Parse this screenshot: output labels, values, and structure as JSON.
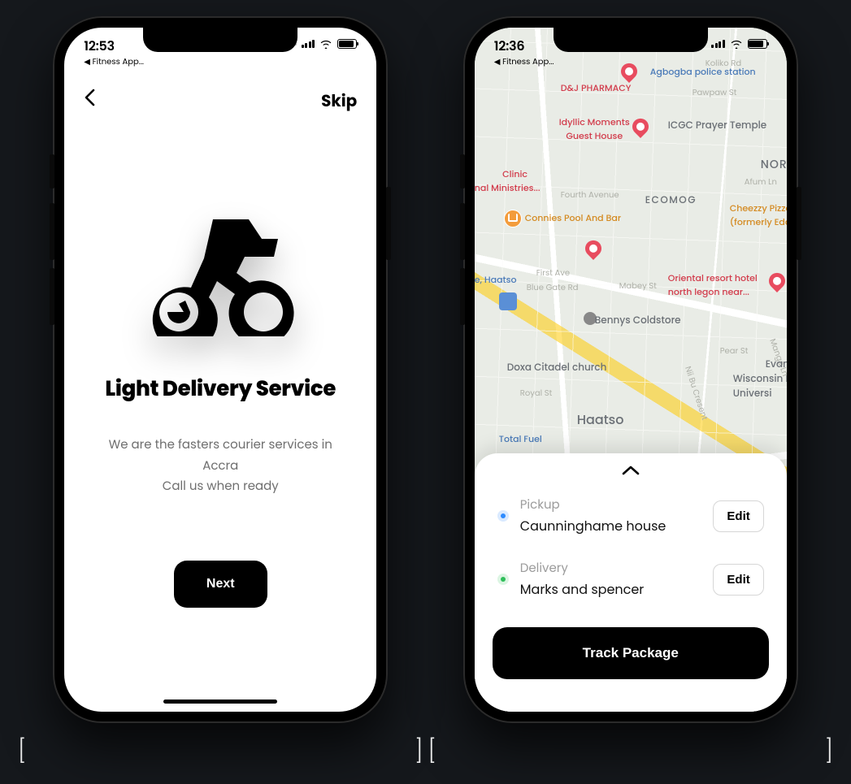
{
  "screen1": {
    "status": {
      "time": "12:53",
      "back_app": "◀ Fitness App..."
    },
    "nav": {
      "skip": "Skip"
    },
    "title": "Light Delivery Service",
    "subtitle_line1": "We are the fasters courier services in Accra",
    "subtitle_line2": "Call us when ready",
    "next_label": "Next"
  },
  "screen2": {
    "status": {
      "time": "12:36",
      "back_app": "◀ Fitness App..."
    },
    "map": {
      "labels": {
        "dj_pharmacy": "D&J PHARMACY",
        "agbogba_police": "Agbogba police station",
        "pawpaw": "Pawpaw St",
        "koliko": "Koliko Rd",
        "idyllic": "Idyllic Moments\nGuest House",
        "icgc": "ICGC Prayer Temple",
        "nor": "NOR",
        "clinic": "            Clinic\nnal Ministries...",
        "fourth": "Fourth Avenue",
        "ecomog": "ECOMOG",
        "afum": "Afum Ln",
        "cheezzy": "Cheezzy Pizza H\n(formerly Eddys…",
        "connies": "Connies Pool And Bar",
        "first": "First Ave",
        "haatso_e": "e, Haatso",
        "bluegate": "Blue Gate Rd",
        "mabey": "Mabey St",
        "oriental": "Oriental resort hotel\nnorth legon near...",
        "bennys": "Bennys Coldstore",
        "pear": "Pear St",
        "mango": "Mango Ln",
        "doxa": "Doxa Citadel church",
        "evan": "Evan",
        "wisconsin": "Wisconsin In\nUniversi",
        "royal": "Royal St",
        "niibu": "Nii Bu Cresent",
        "haatso": "Haatso",
        "totalfuel": "Total Fuel"
      }
    },
    "sheet": {
      "pickup_label": "Pickup",
      "pickup_value": "Caunninghame house",
      "delivery_label": "Delivery",
      "delivery_value": "Marks and spencer",
      "edit_label": "Edit",
      "track_label": "Track Package"
    }
  }
}
